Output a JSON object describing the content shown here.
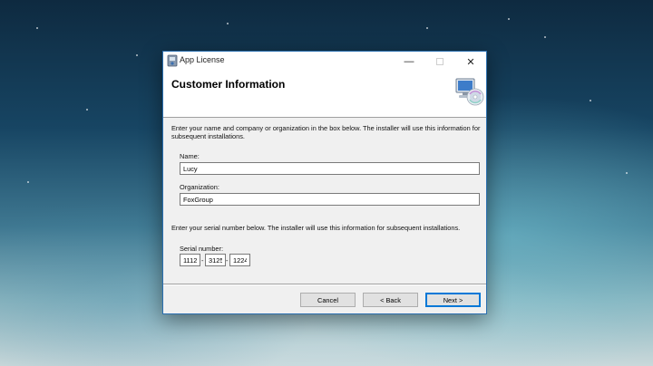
{
  "window": {
    "title": "App License",
    "minimize_label": "—",
    "close_label": "✕"
  },
  "header": {
    "title": "Customer Information",
    "icon": "setup-computer-disc-icon"
  },
  "form": {
    "intro_text": "Enter your name and company or organization in the box below. The installer will use this information for subsequent installations.",
    "name_label": "Name:",
    "name_value": "Lucy",
    "organization_label": "Organization:",
    "organization_value": "FoxGroup",
    "serial_intro_text": "Enter your serial number below. The installer will use this information for subsequent installations.",
    "serial_label": "Serial number:",
    "serial_parts": [
      "1112",
      "3125",
      "1224"
    ],
    "serial_separator": "-"
  },
  "buttons": {
    "cancel": "Cancel",
    "back": "< Back",
    "next": "Next >"
  }
}
